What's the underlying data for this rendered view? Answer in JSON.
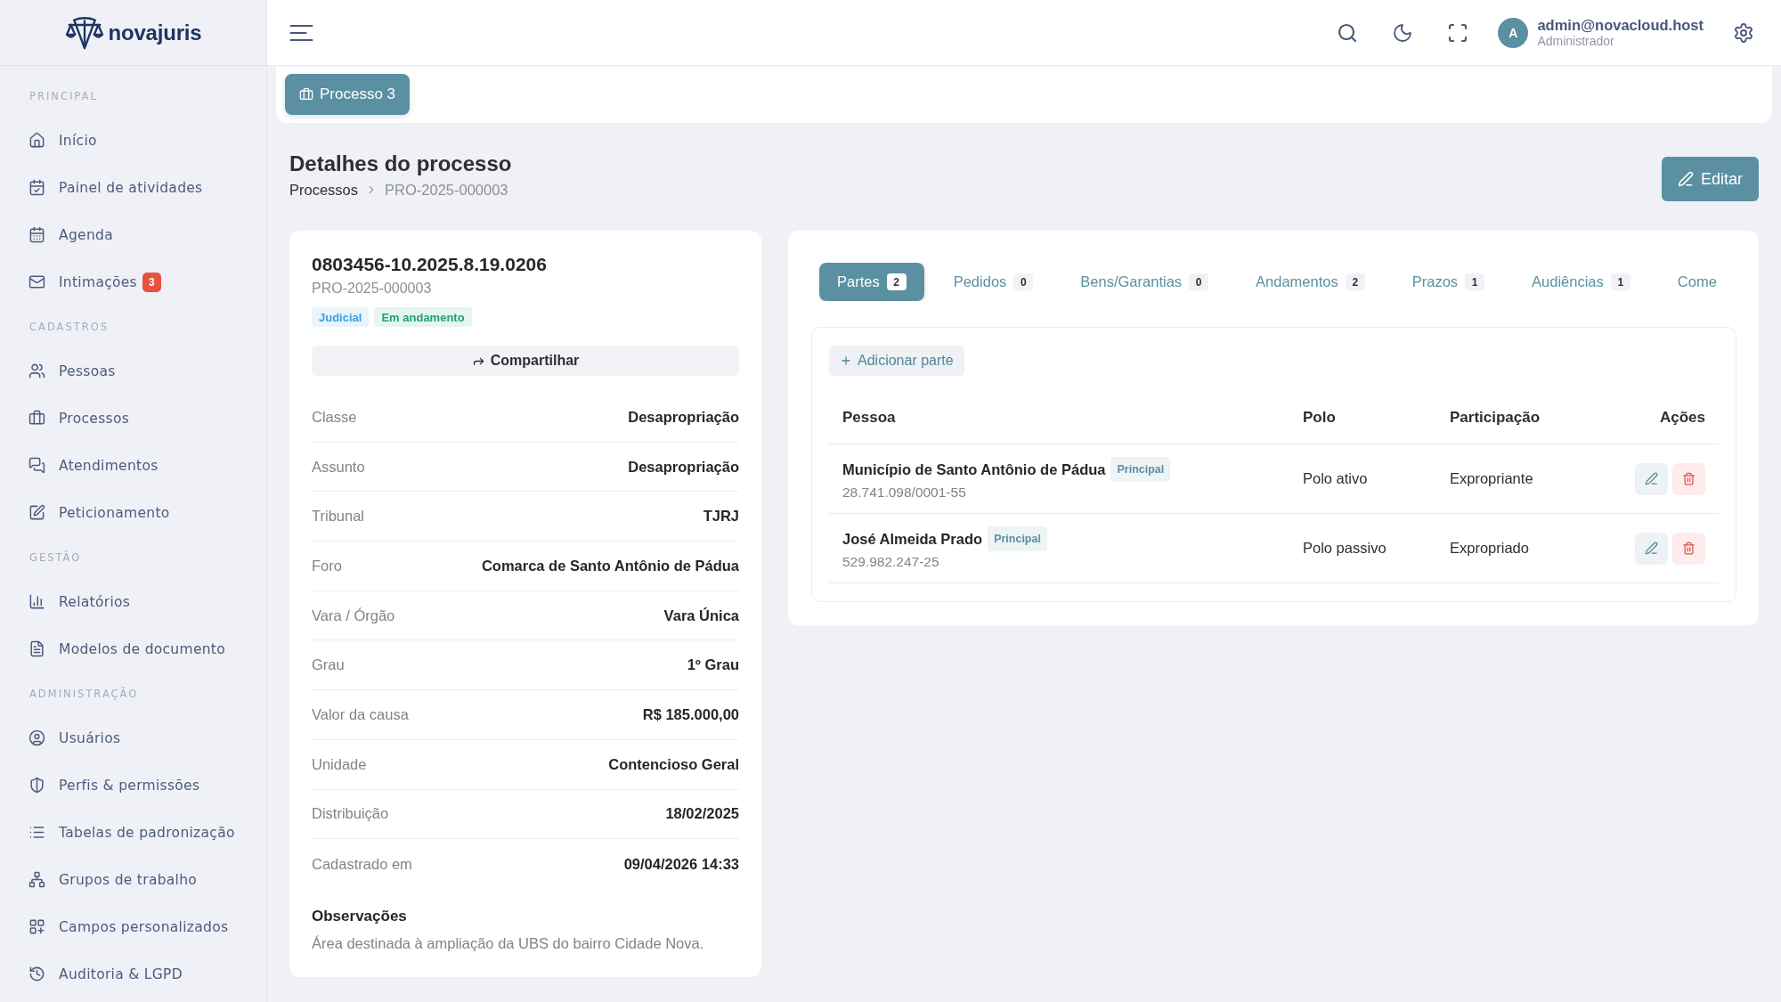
{
  "sidebar": {
    "logo": {
      "text": "novajuris"
    },
    "sections": [
      {
        "title": "PRINCIPAL",
        "items": [
          {
            "label": "Início"
          },
          {
            "label": "Painel de atividades"
          },
          {
            "label": "Agenda"
          },
          {
            "label": "Intimações",
            "badge": "3"
          }
        ]
      },
      {
        "title": "CADASTROS",
        "items": [
          {
            "label": "Pessoas"
          },
          {
            "label": "Processos"
          },
          {
            "label": "Atendimentos"
          },
          {
            "label": "Peticionamento"
          }
        ]
      },
      {
        "title": "GESTÃO",
        "items": [
          {
            "label": "Relatórios"
          },
          {
            "label": "Modelos de documento"
          }
        ]
      },
      {
        "title": "ADMINISTRAÇÃO",
        "items": [
          {
            "label": "Usuários"
          },
          {
            "label": "Perfis & permissões"
          },
          {
            "label": "Tabelas de padronização"
          },
          {
            "label": "Grupos de trabalho"
          },
          {
            "label": "Campos personalizados"
          },
          {
            "label": "Auditoria & LGPD"
          }
        ]
      }
    ]
  },
  "topbar": {
    "user": {
      "initial": "A",
      "email": "admin@novacloud.host",
      "role": "Administrador"
    }
  },
  "open_tabs": [
    {
      "label": "Processo 3",
      "selected": true
    }
  ],
  "page_header": {
    "title": "Detalhes do processo",
    "breadcrumb": [
      "Processos",
      "PRO-2025-000003"
    ],
    "edit_button": "Editar"
  },
  "process_card": {
    "number": "0803456-10.2025.8.19.0206",
    "code": "PRO-2025-000003",
    "tags": [
      {
        "label": "Judicial",
        "color": "#3a9fe0"
      },
      {
        "label": "Em andamento",
        "color": "#1fa36f"
      }
    ],
    "share_button": "Compartilhar",
    "fields": [
      {
        "label": "Classe",
        "value": "Desapropriação"
      },
      {
        "label": "Assunto",
        "value": "Desapropriação"
      },
      {
        "label": "Tribunal",
        "value": "TJRJ"
      },
      {
        "label": "Foro",
        "value": "Comarca de Santo Antônio de Pádua"
      },
      {
        "label": "Vara / Órgão",
        "value": "Vara Única"
      },
      {
        "label": "Grau",
        "value": "1º Grau"
      },
      {
        "label": "Valor da causa",
        "value": "R$ 185.000,00"
      },
      {
        "label": "Unidade",
        "value": "Contencioso Geral"
      },
      {
        "label": "Distribuição",
        "value": "18/02/2025"
      },
      {
        "label": "Cadastrado em",
        "value": "09/04/2026 14:33"
      }
    ],
    "notes": {
      "title": "Observações",
      "text": "Área destinada à ampliação da UBS do bairro Cidade Nova."
    }
  },
  "detail_tabs": [
    {
      "label": "Partes",
      "count": "2",
      "selected": true
    },
    {
      "label": "Pedidos",
      "count": "0",
      "selected": false
    },
    {
      "label": "Bens/Garantias",
      "count": "0",
      "selected": false
    },
    {
      "label": "Andamentos",
      "count": "2",
      "selected": false
    },
    {
      "label": "Prazos",
      "count": "1",
      "selected": false
    },
    {
      "label": "Audiências",
      "count": "1",
      "selected": false
    },
    {
      "label": "Come",
      "selected": false
    }
  ],
  "parties": {
    "add_button": "Adicionar parte",
    "columns": [
      "Pessoa",
      "Polo",
      "Participação",
      "Ações"
    ],
    "rows": [
      {
        "name": "Município de Santo Antônio de Pádua",
        "tag": "Principal",
        "document": "28.741.098/0001-55",
        "polo": "Polo ativo",
        "participation": "Expropriante"
      },
      {
        "name": "José Almeida Prado",
        "tag": "Principal",
        "document": "529.982.247-25",
        "polo": "Polo passivo",
        "participation": "Expropriado"
      }
    ]
  }
}
